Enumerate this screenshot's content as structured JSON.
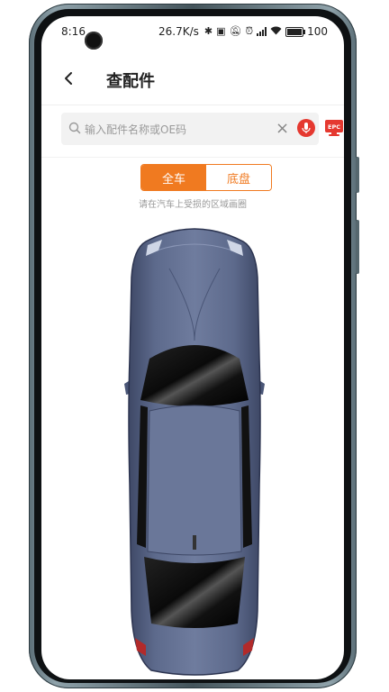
{
  "status_bar": {
    "time": "8:16",
    "net_speed": "26.7K/s",
    "battery": "100"
  },
  "header": {
    "title": "查配件"
  },
  "search": {
    "placeholder": "输入配件名称或OE码",
    "epc_label": "EPC"
  },
  "toggle": {
    "options": [
      "全车",
      "底盘"
    ],
    "selected": "全车"
  },
  "hint": "请在汽车上受损的区域画圈",
  "colors": {
    "accent": "#f07a20",
    "mic": "#e53930",
    "car_body": "#5a6788"
  }
}
